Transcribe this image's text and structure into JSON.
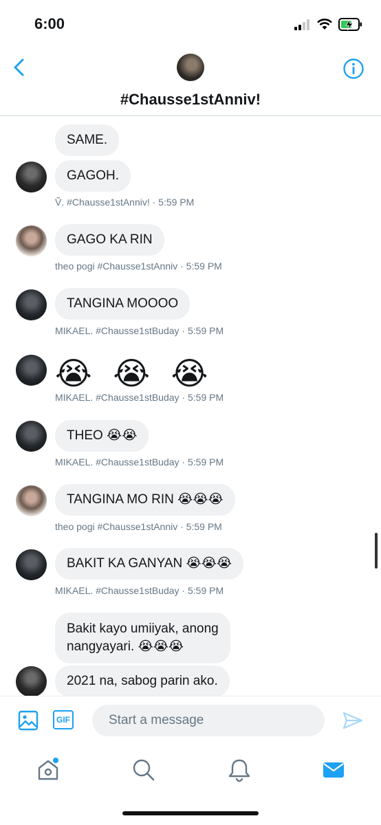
{
  "status_bar": {
    "time": "6:00"
  },
  "header": {
    "title": "#Chausse1stAnniv!"
  },
  "messages": [
    {
      "text": "SAME."
    },
    {
      "text": "GAGOH."
    },
    {
      "meta": "Ṽ. #Chausse1stAnniv! · 5:59 PM"
    },
    {
      "text": "GAGO KA RIN",
      "meta": "theo pogi #Chausse1stAnniv · 5:59 PM"
    },
    {
      "text": "TANGINA MOOOO",
      "meta": "MIKAEL. #Chausse1stBuday · 5:59 PM"
    },
    {
      "text": "😭 😭 😭",
      "meta": "MIKAEL. #Chausse1stBuday · 5:59 PM"
    },
    {
      "text": "THEO 😭😭",
      "meta": "MIKAEL. #Chausse1stBuday · 5:59 PM"
    },
    {
      "text": "TANGINA MO RIN 😭😭😭",
      "meta": "theo pogi #Chausse1stAnniv · 5:59 PM"
    },
    {
      "text": "BAKIT KA GANYAN 😭😭😭",
      "meta": "MIKAEL. #Chausse1stBuday · 5:59 PM"
    },
    {
      "text_line1": "Bakit kayo umiiyak, anong",
      "text_line2": "nangyayari. 😭😭😭"
    },
    {
      "text": "2021 na, sabog parin ako."
    }
  ],
  "composer": {
    "placeholder": "Start a message",
    "gif_label": "GIF"
  },
  "colors": {
    "accent": "#1da1f2",
    "bubble": "#eff1f3",
    "meta": "#657786"
  }
}
